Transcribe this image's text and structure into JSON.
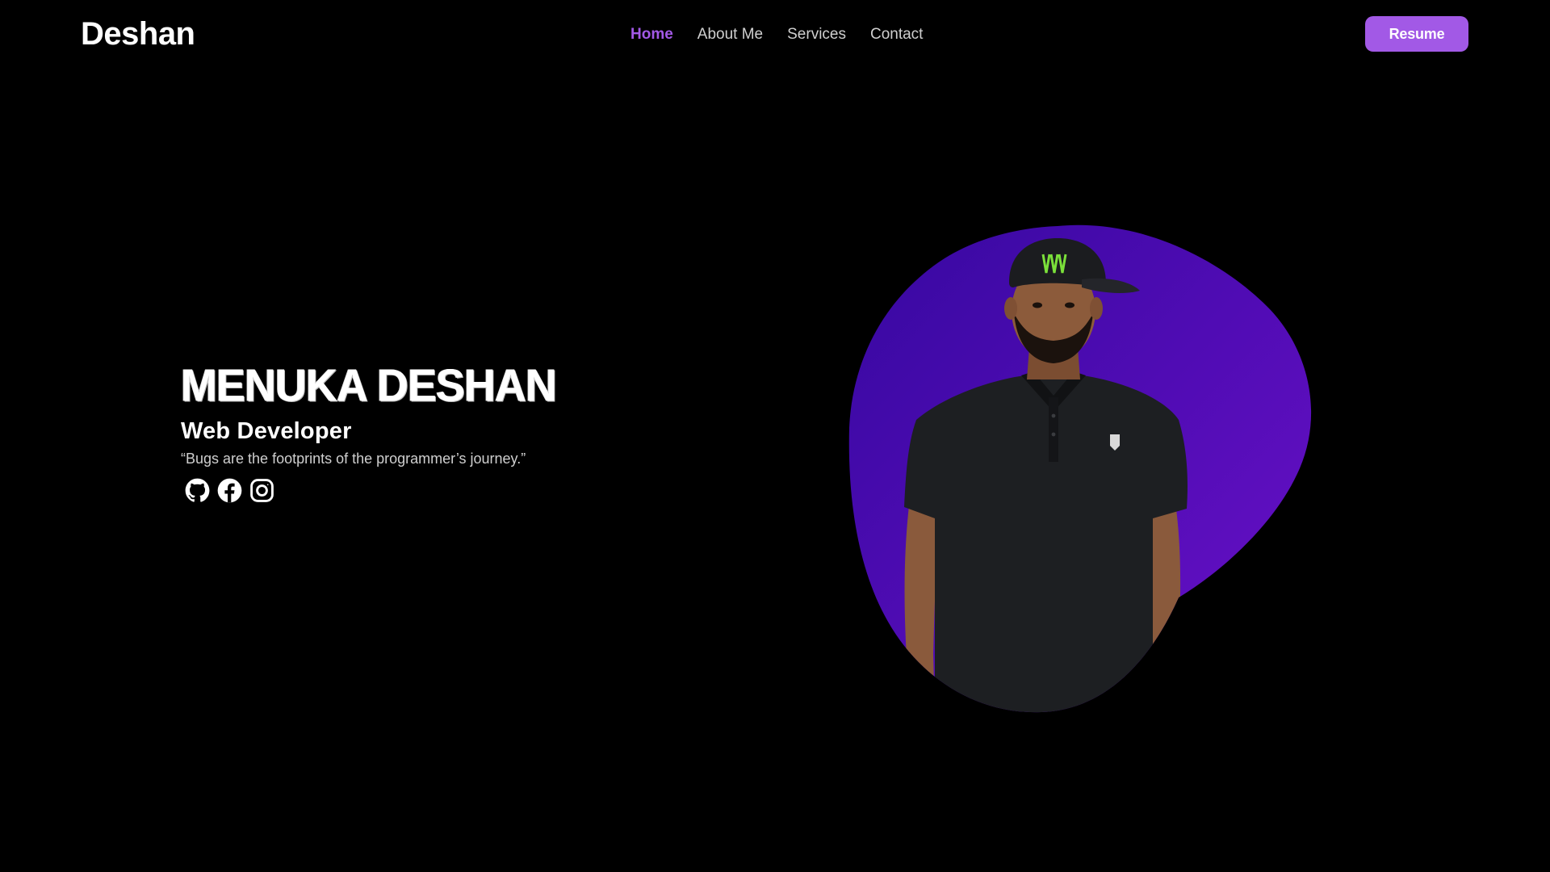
{
  "header": {
    "brand": "Deshan",
    "nav": [
      {
        "label": "Home",
        "active": true
      },
      {
        "label": "About Me",
        "active": false
      },
      {
        "label": "Services",
        "active": false
      },
      {
        "label": "Contact",
        "active": false
      }
    ],
    "resume_label": "Resume"
  },
  "hero": {
    "name": "MENUKA DESHAN",
    "role": "Web Developer",
    "quote": "“Bugs are the footprints of the programmer’s journey.”",
    "socials": [
      {
        "icon": "github-icon"
      },
      {
        "icon": "facebook-icon"
      },
      {
        "icon": "instagram-icon"
      }
    ],
    "portrait_icon": "portrait-photo"
  },
  "colors": {
    "background": "#000000",
    "accent": "#a259e6",
    "blob_dark": "#3a0aa6",
    "blob_light": "#5a0bc0",
    "text": "#ffffff",
    "muted_text": "#cfcfcf"
  }
}
